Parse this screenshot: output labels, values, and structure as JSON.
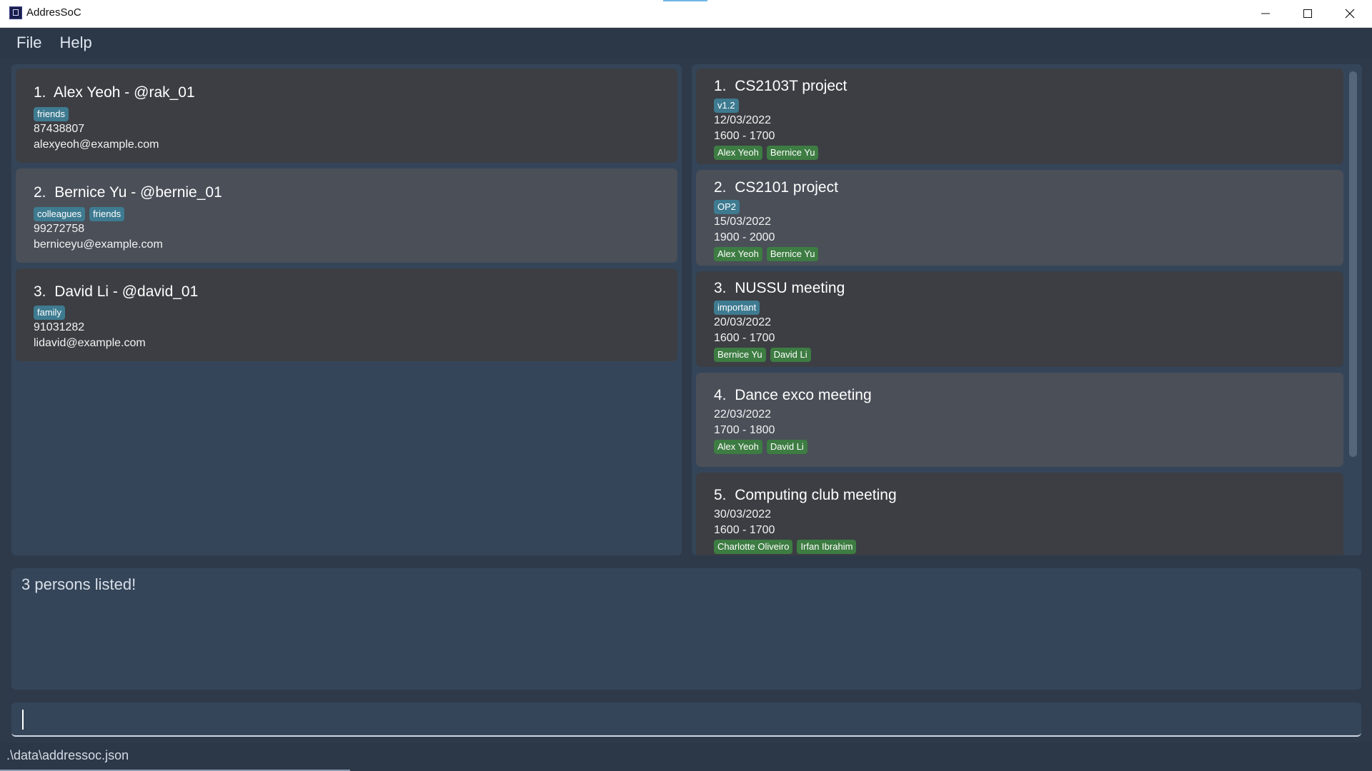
{
  "window": {
    "title": "AddresSoC",
    "icon": "app-icon"
  },
  "menu": {
    "items": [
      "File",
      "Help"
    ]
  },
  "persons": [
    {
      "index": "1.",
      "name": "Alex Yeoh",
      "handle": "@rak_01",
      "tags": [
        "friends"
      ],
      "phone": "87438807",
      "email": "alexyeoh@example.com"
    },
    {
      "index": "2.",
      "name": "Bernice Yu",
      "handle": "@bernie_01",
      "tags": [
        "colleagues",
        "friends"
      ],
      "phone": "99272758",
      "email": "berniceyu@example.com"
    },
    {
      "index": "3.",
      "name": "David Li",
      "handle": "@david_01",
      "tags": [
        "family"
      ],
      "phone": "91031282",
      "email": "lidavid@example.com"
    }
  ],
  "events": [
    {
      "index": "1.",
      "name": "CS2103T project",
      "tags": [
        "v1.2"
      ],
      "date": "12/03/2022",
      "time": "1600 - 1700",
      "participants": [
        "Alex Yeoh",
        "Bernice Yu"
      ]
    },
    {
      "index": "2.",
      "name": "CS2101 project",
      "tags": [
        "OP2"
      ],
      "date": "15/03/2022",
      "time": "1900 - 2000",
      "participants": [
        "Alex Yeoh",
        "Bernice Yu"
      ]
    },
    {
      "index": "3.",
      "name": "NUSSU meeting",
      "tags": [
        "important"
      ],
      "date": "20/03/2022",
      "time": "1600 - 1700",
      "participants": [
        "Bernice Yu",
        "David Li"
      ]
    },
    {
      "index": "4.",
      "name": "Dance exco meeting",
      "tags": [],
      "date": "22/03/2022",
      "time": "1700 - 1800",
      "participants": [
        "Alex Yeoh",
        "David Li"
      ]
    },
    {
      "index": "5.",
      "name": "Computing club meeting",
      "tags": [],
      "date": "30/03/2022",
      "time": "1600 - 1700",
      "participants": [
        "Charlotte Oliveiro",
        "Irfan Ibrahim"
      ]
    }
  ],
  "result": {
    "message": "3 persons listed!"
  },
  "command": {
    "value": ""
  },
  "status": {
    "file_path": ".\\data\\addressoc.json"
  },
  "colors": {
    "background": "#2e3a4a",
    "panel": "#354559",
    "card": "#3c3e43",
    "card_selected": "#4a4f58",
    "tag_blue": "#3e7b91",
    "tag_green": "#3d7c42"
  }
}
